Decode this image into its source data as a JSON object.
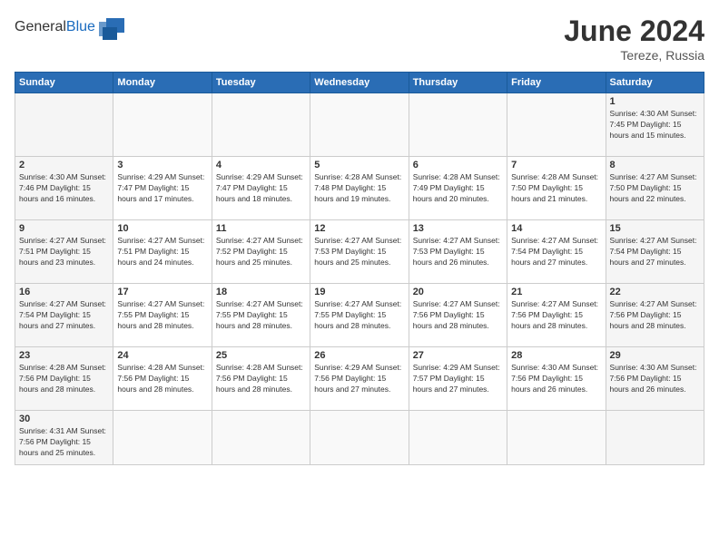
{
  "header": {
    "logo_general": "General",
    "logo_blue": "Blue",
    "title": "June 2024",
    "subtitle": "Tereze, Russia"
  },
  "weekdays": [
    "Sunday",
    "Monday",
    "Tuesday",
    "Wednesday",
    "Thursday",
    "Friday",
    "Saturday"
  ],
  "weeks": [
    [
      {
        "day": "",
        "info": ""
      },
      {
        "day": "",
        "info": ""
      },
      {
        "day": "",
        "info": ""
      },
      {
        "day": "",
        "info": ""
      },
      {
        "day": "",
        "info": ""
      },
      {
        "day": "",
        "info": ""
      },
      {
        "day": "1",
        "info": "Sunrise: 4:30 AM\nSunset: 7:45 PM\nDaylight: 15 hours and 15 minutes."
      }
    ],
    [
      {
        "day": "2",
        "info": "Sunrise: 4:30 AM\nSunset: 7:46 PM\nDaylight: 15 hours and 16 minutes."
      },
      {
        "day": "3",
        "info": "Sunrise: 4:29 AM\nSunset: 7:47 PM\nDaylight: 15 hours and 17 minutes."
      },
      {
        "day": "4",
        "info": "Sunrise: 4:29 AM\nSunset: 7:47 PM\nDaylight: 15 hours and 18 minutes."
      },
      {
        "day": "5",
        "info": "Sunrise: 4:28 AM\nSunset: 7:48 PM\nDaylight: 15 hours and 19 minutes."
      },
      {
        "day": "6",
        "info": "Sunrise: 4:28 AM\nSunset: 7:49 PM\nDaylight: 15 hours and 20 minutes."
      },
      {
        "day": "7",
        "info": "Sunrise: 4:28 AM\nSunset: 7:50 PM\nDaylight: 15 hours and 21 minutes."
      },
      {
        "day": "8",
        "info": "Sunrise: 4:27 AM\nSunset: 7:50 PM\nDaylight: 15 hours and 22 minutes."
      }
    ],
    [
      {
        "day": "9",
        "info": "Sunrise: 4:27 AM\nSunset: 7:51 PM\nDaylight: 15 hours and 23 minutes."
      },
      {
        "day": "10",
        "info": "Sunrise: 4:27 AM\nSunset: 7:51 PM\nDaylight: 15 hours and 24 minutes."
      },
      {
        "day": "11",
        "info": "Sunrise: 4:27 AM\nSunset: 7:52 PM\nDaylight: 15 hours and 25 minutes."
      },
      {
        "day": "12",
        "info": "Sunrise: 4:27 AM\nSunset: 7:53 PM\nDaylight: 15 hours and 25 minutes."
      },
      {
        "day": "13",
        "info": "Sunrise: 4:27 AM\nSunset: 7:53 PM\nDaylight: 15 hours and 26 minutes."
      },
      {
        "day": "14",
        "info": "Sunrise: 4:27 AM\nSunset: 7:54 PM\nDaylight: 15 hours and 27 minutes."
      },
      {
        "day": "15",
        "info": "Sunrise: 4:27 AM\nSunset: 7:54 PM\nDaylight: 15 hours and 27 minutes."
      }
    ],
    [
      {
        "day": "16",
        "info": "Sunrise: 4:27 AM\nSunset: 7:54 PM\nDaylight: 15 hours and 27 minutes."
      },
      {
        "day": "17",
        "info": "Sunrise: 4:27 AM\nSunset: 7:55 PM\nDaylight: 15 hours and 28 minutes."
      },
      {
        "day": "18",
        "info": "Sunrise: 4:27 AM\nSunset: 7:55 PM\nDaylight: 15 hours and 28 minutes."
      },
      {
        "day": "19",
        "info": "Sunrise: 4:27 AM\nSunset: 7:55 PM\nDaylight: 15 hours and 28 minutes."
      },
      {
        "day": "20",
        "info": "Sunrise: 4:27 AM\nSunset: 7:56 PM\nDaylight: 15 hours and 28 minutes."
      },
      {
        "day": "21",
        "info": "Sunrise: 4:27 AM\nSunset: 7:56 PM\nDaylight: 15 hours and 28 minutes."
      },
      {
        "day": "22",
        "info": "Sunrise: 4:27 AM\nSunset: 7:56 PM\nDaylight: 15 hours and 28 minutes."
      }
    ],
    [
      {
        "day": "23",
        "info": "Sunrise: 4:28 AM\nSunset: 7:56 PM\nDaylight: 15 hours and 28 minutes."
      },
      {
        "day": "24",
        "info": "Sunrise: 4:28 AM\nSunset: 7:56 PM\nDaylight: 15 hours and 28 minutes."
      },
      {
        "day": "25",
        "info": "Sunrise: 4:28 AM\nSunset: 7:56 PM\nDaylight: 15 hours and 28 minutes."
      },
      {
        "day": "26",
        "info": "Sunrise: 4:29 AM\nSunset: 7:56 PM\nDaylight: 15 hours and 27 minutes."
      },
      {
        "day": "27",
        "info": "Sunrise: 4:29 AM\nSunset: 7:57 PM\nDaylight: 15 hours and 27 minutes."
      },
      {
        "day": "28",
        "info": "Sunrise: 4:30 AM\nSunset: 7:56 PM\nDaylight: 15 hours and 26 minutes."
      },
      {
        "day": "29",
        "info": "Sunrise: 4:30 AM\nSunset: 7:56 PM\nDaylight: 15 hours and 26 minutes."
      }
    ],
    [
      {
        "day": "30",
        "info": "Sunrise: 4:31 AM\nSunset: 7:56 PM\nDaylight: 15 hours and 25 minutes."
      },
      {
        "day": "",
        "info": ""
      },
      {
        "day": "",
        "info": ""
      },
      {
        "day": "",
        "info": ""
      },
      {
        "day": "",
        "info": ""
      },
      {
        "day": "",
        "info": ""
      },
      {
        "day": "",
        "info": ""
      }
    ]
  ]
}
